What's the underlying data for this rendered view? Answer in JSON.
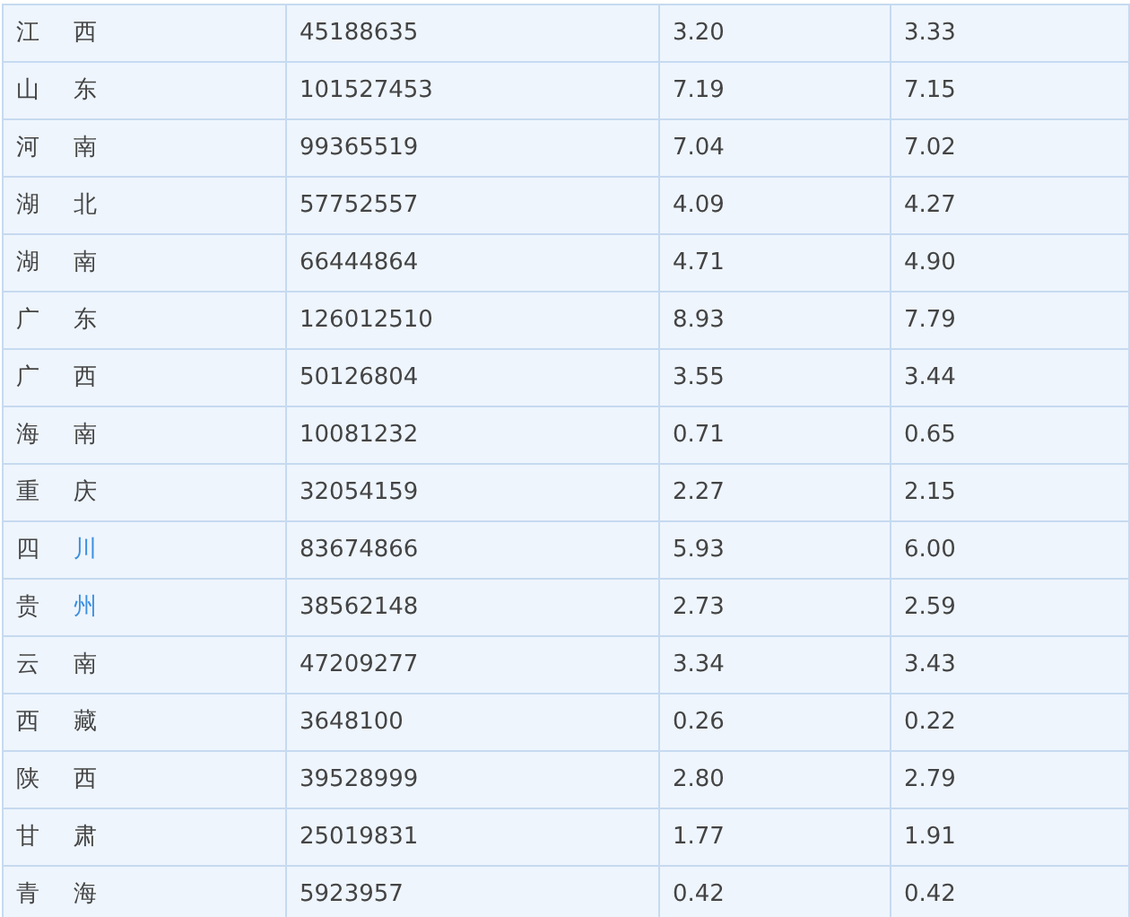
{
  "table": {
    "rows": [
      {
        "province": [
          {
            "text": "江",
            "link": false
          },
          {
            "text": "西",
            "link": false
          }
        ],
        "cells": [
          "45188635",
          "3.20",
          "3.33"
        ]
      },
      {
        "province": [
          {
            "text": "山",
            "link": false
          },
          {
            "text": "东",
            "link": false
          }
        ],
        "cells": [
          "101527453",
          "7.19",
          "7.15"
        ]
      },
      {
        "province": [
          {
            "text": "河",
            "link": false
          },
          {
            "text": "南",
            "link": false
          }
        ],
        "cells": [
          "99365519",
          "7.04",
          "7.02"
        ]
      },
      {
        "province": [
          {
            "text": "湖",
            "link": false
          },
          {
            "text": "北",
            "link": false
          }
        ],
        "cells": [
          "57752557",
          "4.09",
          "4.27"
        ]
      },
      {
        "province": [
          {
            "text": "湖",
            "link": false
          },
          {
            "text": "南",
            "link": false
          }
        ],
        "cells": [
          "66444864",
          "4.71",
          "4.90"
        ]
      },
      {
        "province": [
          {
            "text": "广",
            "link": false
          },
          {
            "text": "东",
            "link": false
          }
        ],
        "cells": [
          "126012510",
          "8.93",
          "7.79"
        ]
      },
      {
        "province": [
          {
            "text": "广",
            "link": false
          },
          {
            "text": "西",
            "link": false
          }
        ],
        "cells": [
          "50126804",
          "3.55",
          "3.44"
        ]
      },
      {
        "province": [
          {
            "text": "海",
            "link": false
          },
          {
            "text": "南",
            "link": false
          }
        ],
        "cells": [
          "10081232",
          "0.71",
          "0.65"
        ]
      },
      {
        "province": [
          {
            "text": "重",
            "link": false
          },
          {
            "text": "庆",
            "link": false
          }
        ],
        "cells": [
          "32054159",
          "2.27",
          "2.15"
        ]
      },
      {
        "province": [
          {
            "text": "四",
            "link": false
          },
          {
            "text": "川",
            "link": true
          }
        ],
        "cells": [
          "83674866",
          "5.93",
          "6.00"
        ]
      },
      {
        "province": [
          {
            "text": "贵",
            "link": false
          },
          {
            "text": "州",
            "link": true
          }
        ],
        "cells": [
          "38562148",
          "2.73",
          "2.59"
        ]
      },
      {
        "province": [
          {
            "text": "云",
            "link": false
          },
          {
            "text": "南",
            "link": false
          }
        ],
        "cells": [
          "47209277",
          "3.34",
          "3.43"
        ]
      },
      {
        "province": [
          {
            "text": "西",
            "link": false
          },
          {
            "text": "藏",
            "link": false
          }
        ],
        "cells": [
          "3648100",
          "0.26",
          "0.22"
        ]
      },
      {
        "province": [
          {
            "text": "陕",
            "link": false
          },
          {
            "text": "西",
            "link": false
          }
        ],
        "cells": [
          "39528999",
          "2.80",
          "2.79"
        ]
      },
      {
        "province": [
          {
            "text": "甘",
            "link": false
          },
          {
            "text": "肃",
            "link": false
          }
        ],
        "cells": [
          "25019831",
          "1.77",
          "1.91"
        ]
      },
      {
        "province": [
          {
            "text": "青",
            "link": false
          },
          {
            "text": "海",
            "link": false
          }
        ],
        "cells": [
          "5923957",
          "0.42",
          "0.42"
        ]
      }
    ]
  }
}
